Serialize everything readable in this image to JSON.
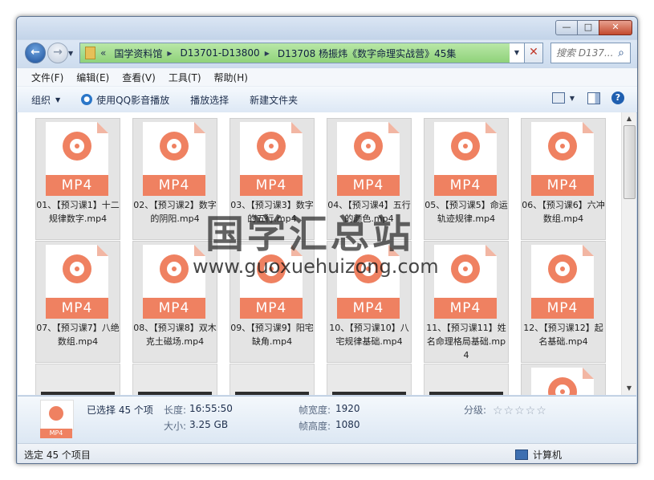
{
  "window": {
    "buttons": {
      "minimize": "—",
      "maximize": "□",
      "close": "✕"
    }
  },
  "address": {
    "lead": "«",
    "crumbs": [
      "国学资料馆",
      "D13701-D13800",
      "D13708 杨振炜《数字命理实战营》45集"
    ]
  },
  "search": {
    "placeholder": "搜索 D137..."
  },
  "menu": [
    "文件(F)",
    "编辑(E)",
    "查看(V)",
    "工具(T)",
    "帮助(H)"
  ],
  "toolbar": {
    "organize": "组织",
    "play_qq": "使用QQ影音播放",
    "play_selection": "播放选择",
    "new_folder": "新建文件夹"
  },
  "file_badge": "MP4",
  "files": [
    "01、【预习课1】十二规律数字.mp4",
    "02、【预习课2】数字的阴阳.mp4",
    "03、【预习课3】数字的五行.mp4",
    "04、【预习课4】五行的颜色.mp4",
    "05、【预习课5】命运轨迹规律.mp4",
    "06、【预习课6】六冲数组.mp4",
    "07、【预习课7】八绝数组.mp4",
    "08、【预习课8】双木克土磁场.mp4",
    "09、【预习课9】阳宅缺角.mp4",
    "10、【预习课10】八宅规律基础.mp4",
    "11、【预习课11】姓名命理格局基础.mp4",
    "12、【预习课12】起名基础.mp4"
  ],
  "watermark": {
    "title": "国学汇总站",
    "url": "www.guoxuehuizong.com"
  },
  "details": {
    "selected": "已选择 45 个项",
    "length_label": "长度:",
    "length_value": "16:55:50",
    "size_label": "大小:",
    "size_value": "3.25 GB",
    "frame_width_label": "帧宽度:",
    "frame_width_value": "1920",
    "frame_height_label": "帧高度:",
    "frame_height_value": "1080",
    "rating_label": "分级:",
    "rating_stars": "☆☆☆☆☆",
    "icon_badge": "MP4"
  },
  "status": {
    "left": "选定 45 个项目",
    "right": "计算机"
  }
}
